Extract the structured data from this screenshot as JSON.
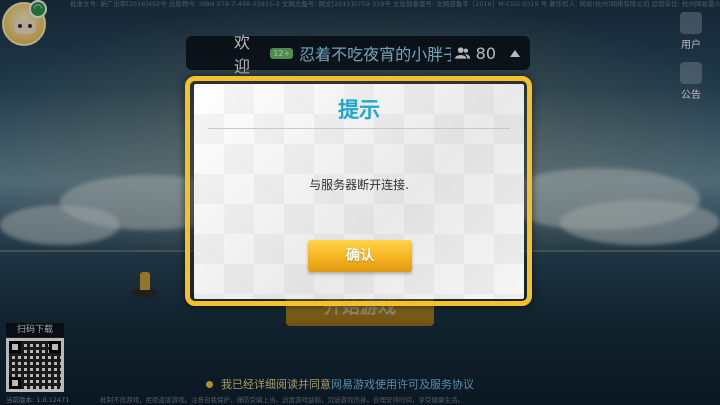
{
  "legal_top": "批准文号: 新广出审[2016]492号  出版物号: ISBN 978-7-498-03915-3  文网文备号: 网文[2015]0759-359号  文化部备案号: 文网游备字〔2016〕M-CSG 0319 号  著作权人: 网易(杭州)网络有限公司  运营单位: 杭州网易雷火科技有限公司",
  "welcome": {
    "greeting": "欢迎",
    "age_badge": "12+",
    "username": "忍着不吃夜宵的小胖子",
    "online_count": "80"
  },
  "side": {
    "user_label": "用户",
    "notice_label": "公告"
  },
  "start_button": "开始游戏",
  "qr": {
    "label": "扫码下载",
    "version": "当前版本: 1.0.12471"
  },
  "agreement": {
    "prefix": "我已经详细阅读并同意",
    "link": "网易游戏使用许可及服务协议"
  },
  "footer_note": "抵制不良游戏，拒绝盗版游戏。注意自我保护，谨防受骗上当。适度游戏益脑，沉迷游戏伤身。合理安排时间，享受健康生活。",
  "dialog": {
    "title": "提示",
    "message": "与服务器断开连接.",
    "confirm_label": "确认"
  },
  "colors": {
    "accent_gold": "#f3c22a",
    "title_cyan": "#1da7c8",
    "link_blue": "#7fc3ea"
  }
}
